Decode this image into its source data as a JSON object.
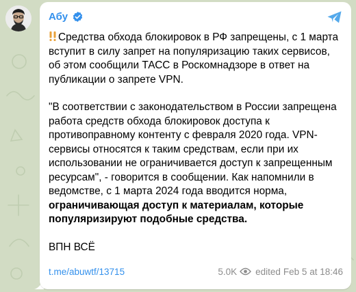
{
  "channel": {
    "name": "Абу"
  },
  "post": {
    "headline": "Средства обхода блокировок в РФ запрещены, с 1 марта вступит в силу запрет на популяризацию таких сервисов, об этом сообщили ТАСС в Роскомнадзоре в ответ на публикации о запрете VPN.",
    "quote": "\"В соответствии с законодательством в России запрещена работа средств обхода блокировок доступа к противоправному контенту с февраля 2020 года. VPN-сервисы относятся к таким средствам, если при их использовании не ограничивается доступ к запрещенным ресурсам\", - говорится в сообщении. Как напомнили в ведомстве, с 1 марта 2024 года вводится норма, ",
    "quote_bold": "ограничивающая доступ к материалам, которые популяризируют подобные средства.",
    "signoff": "ВПН ВСЁ"
  },
  "footer": {
    "link": "t.me/abuwtf/13715",
    "views": "5.0K",
    "edited": "edited",
    "time": "Feb 5 at 18:46"
  },
  "icons": {
    "avatar": "avatar-portrait",
    "verified": "verified-badge-icon",
    "share": "share-arrow-icon",
    "alert": "double-exclamation-icon",
    "views": "eye-icon"
  },
  "colors": {
    "background": "#d2dcc4",
    "accent": "#3390ec",
    "meta": "#8c8c8c",
    "alert": "#e8a13a"
  }
}
